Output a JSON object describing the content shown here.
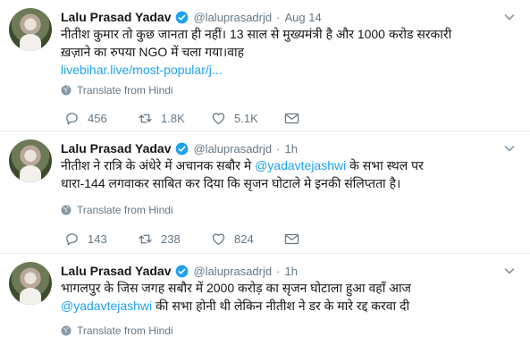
{
  "tweets": [
    {
      "name": "Lalu Prasad Yadav",
      "handle": "@laluprasadrjd",
      "separator": "·",
      "time": "Aug 14",
      "text_line1": "नीतीश कुमार तो कुछ जानता ही नहीं। 13 साल से मुख्यमंत्री है और 1000 करोड सरकारी",
      "text_line2": "ख़ज़ाने का रुपया NGO में चला गया।वाह",
      "link": "livebihar.live/most-popular/j...",
      "translate": "Translate from Hindi",
      "replies": "456",
      "retweets": "1.8K",
      "likes": "5.1K"
    },
    {
      "name": "Lalu Prasad Yadav",
      "handle": "@laluprasadrjd",
      "separator": "·",
      "time": "1h",
      "text_line1_before": "नीतीश ने रात्रि के अंधेरे में अचानक सबौर मे ",
      "mention": "@yadavtejashwi",
      "text_line1_after": " के सभा स्थल पर",
      "text_line2": "धारा-144 लगवाकर साबित कर दिया कि सृजन घोटाले मे इनकी संलिप्तता है।",
      "translate": "Translate from Hindi",
      "replies": "143",
      "retweets": "238",
      "likes": "824"
    },
    {
      "name": "Lalu Prasad Yadav",
      "handle": "@laluprasadrjd",
      "separator": "·",
      "time": "1h",
      "text_line1": "भागलपुर के जिस जगह सबौर में 2000 करोड़ का सृजन घोटाला हुआ वहाँ आज",
      "mention": "@yadavtejashwi",
      "text_line2_after": " की सभा होनी थी लेकिन नीतीश ने डर के मारे रद्द करवा दी",
      "translate": "Translate from Hindi"
    }
  ],
  "colors": {
    "link": "#1da1f2",
    "secondary_text": "#657786",
    "verified": "#1da1f2",
    "divider": "#e6ecf0"
  },
  "icons": [
    "verified-badge-icon",
    "chevron-down-icon",
    "globe-icon",
    "reply-icon",
    "retweet-icon",
    "like-icon",
    "direct-message-icon"
  ]
}
